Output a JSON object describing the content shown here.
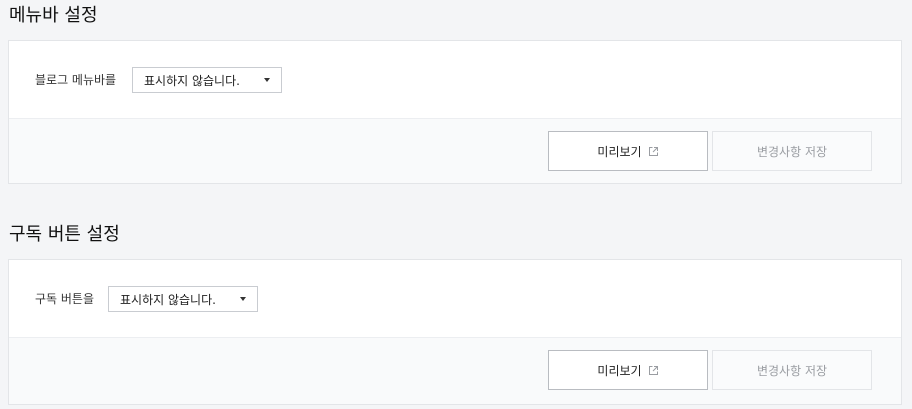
{
  "menubar_section": {
    "title": "메뉴바 설정",
    "field_label": "블로그 메뉴바를",
    "select_value": "표시하지 않습니다.",
    "preview_label": "미리보기",
    "save_label": "변경사항 저장"
  },
  "subscribe_section": {
    "title": "구독 버튼 설정",
    "field_label": "구독 버튼을",
    "select_value": "표시하지 않습니다.",
    "preview_label": "미리보기",
    "save_label": "변경사항 저장"
  },
  "icons": {
    "preview": "external-link-icon",
    "dropdown": "caret-down-icon"
  },
  "colors": {
    "background": "#f4f5f7",
    "panel": "#ffffff",
    "disabled_text": "#9a9da2"
  }
}
